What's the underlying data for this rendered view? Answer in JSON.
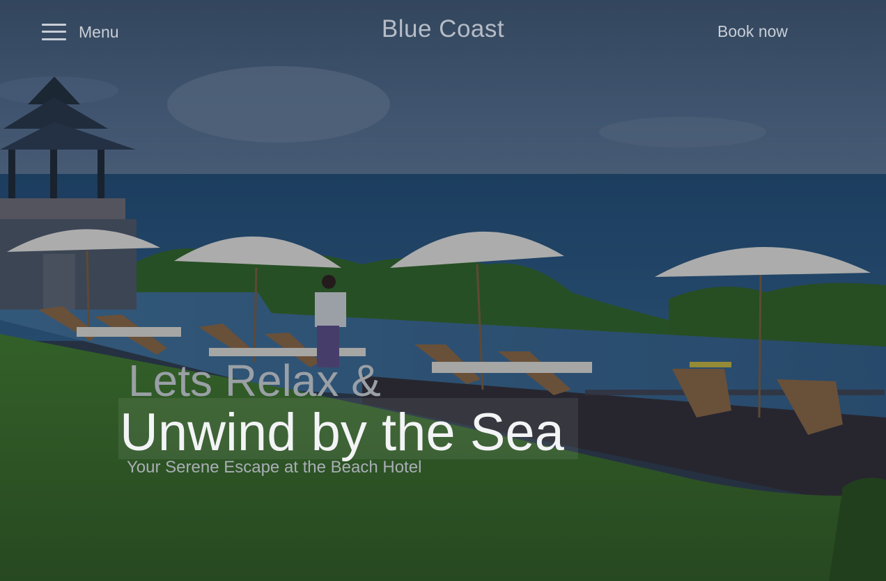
{
  "header": {
    "menu_label": "Menu",
    "brand": "Blue Coast",
    "book_label": "Book now"
  },
  "hero": {
    "line1": "Lets Relax &",
    "line2": "Unwind by the Sea",
    "subtitle": "Your Serene Escape at the Beach Hotel"
  },
  "icons": {
    "menu": "hamburger-menu-icon"
  },
  "colors": {
    "sky": "#4f6784",
    "sea": "#1f4f7a",
    "grass": "#3f6e28",
    "deck": "#2f2a33",
    "pool": "#3d6e97",
    "umbrella": "#e6e4e0",
    "header_text": "#c9ced6",
    "hero_text": "#f3f4f6",
    "hero_dim_text": "#9aa0a6"
  }
}
